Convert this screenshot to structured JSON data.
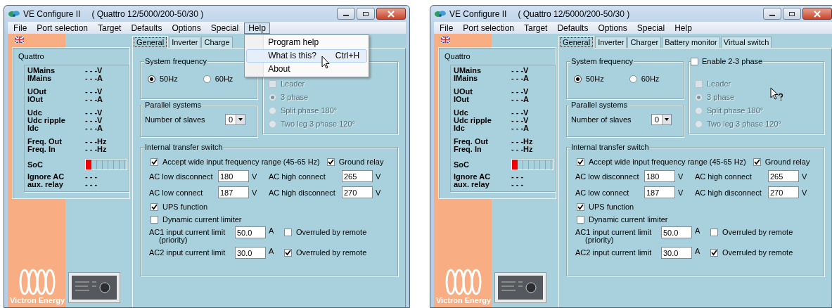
{
  "windows": [
    {
      "title": "VE Configure II",
      "device": "( Quattro 12/5000/200-50/30 )",
      "menu": [
        {
          "label": "File",
          "selected": false
        },
        {
          "label": "Port selection",
          "selected": false
        },
        {
          "label": "Target",
          "selected": false
        },
        {
          "label": "Defaults",
          "selected": false
        },
        {
          "label": "Options",
          "selected": false
        },
        {
          "label": "Special",
          "selected": false
        },
        {
          "label": "Help",
          "selected": true
        }
      ],
      "dropdown": [
        {
          "label": "Program help",
          "selected": false
        },
        {
          "label": "What is this?",
          "shortcut": "Ctrl+H",
          "selected": true
        },
        {
          "label": "About",
          "selected": false
        }
      ],
      "status": {
        "device": "Quattro",
        "groups": [
          [
            {
              "kind": "reading",
              "label": "UMains",
              "value": "- - -V"
            },
            {
              "kind": "reading",
              "label": "IMains",
              "value": "- - -A"
            }
          ],
          [
            {
              "kind": "reading",
              "label": "UOut",
              "value": "- - -V"
            },
            {
              "kind": "reading",
              "label": "IOut",
              "value": "- - -A"
            }
          ],
          [
            {
              "kind": "reading",
              "label": "Udc",
              "value": "- - -V"
            },
            {
              "kind": "reading",
              "label": "Udc ripple",
              "value": "- - -V"
            },
            {
              "kind": "reading",
              "label": "Idc",
              "value": "- - -A"
            }
          ],
          [
            {
              "kind": "reading",
              "label": "Freq. Out",
              "value": "- - -Hz"
            },
            {
              "kind": "reading",
              "label": "Freq. In",
              "value": "- - -Hz"
            }
          ],
          [
            {
              "kind": "meter",
              "label": "SoC",
              "level": 0.14
            },
            {
              "kind": "reading",
              "label": "Ignore AC",
              "value": "- - -"
            },
            {
              "kind": "reading",
              "label": "aux. relay",
              "value": "- - -"
            }
          ]
        ]
      },
      "tabs": [
        {
          "label": "General",
          "selected": true
        },
        {
          "label": "Inverter",
          "selected": false
        },
        {
          "label": "Charge",
          "selected": false
        }
      ],
      "frequency": {
        "title": "System frequency",
        "options": [
          {
            "label": "50Hz",
            "selected": true
          },
          {
            "label": "60Hz",
            "selected": false
          }
        ]
      },
      "parallel": {
        "title": "Parallel systems",
        "label": "Number of slaves",
        "value": "0"
      },
      "phase": {
        "options": [
          {
            "kind": "checkbox",
            "label": "Leader",
            "checked": false,
            "disabled": true
          },
          {
            "kind": "radio",
            "label": "3 phase",
            "selected": true,
            "disabled": true
          },
          {
            "kind": "radio",
            "label": "Split phase 180°",
            "selected": false,
            "disabled": true
          },
          {
            "kind": "radio",
            "label": "Two leg 3 phase 120°",
            "selected": false,
            "disabled": true
          }
        ]
      },
      "transfer": {
        "title": "Internal transfer switch",
        "rows": [
          {
            "kind": "checks",
            "checks": [
              {
                "label": "Accept wide input frequency range (45-65 Hz)",
                "checked": true
              },
              {
                "label": "Ground relay",
                "checked": true
              }
            ]
          },
          {
            "kind": "fields",
            "fields": [
              {
                "label": "AC low disconnect",
                "value": "180",
                "unit": "V"
              },
              {
                "label": "AC high connect",
                "value": "265",
                "unit": "V"
              }
            ]
          },
          {
            "kind": "fields",
            "fields": [
              {
                "label": "AC low connect",
                "value": "187",
                "unit": "V"
              },
              {
                "label": "AC high disconnect",
                "value": "270",
                "unit": "V"
              }
            ]
          },
          {
            "kind": "checks",
            "checks": [
              {
                "label": "UPS function",
                "checked": true
              }
            ]
          },
          {
            "kind": "checks",
            "checks": [
              {
                "label": "Dynamic current limiter",
                "checked": false
              }
            ]
          },
          {
            "kind": "limit",
            "label": "AC1 input current limit",
            "note": "(priority)",
            "value": "50.0",
            "unit": "A",
            "check": {
              "label": "Overruled by remote",
              "checked": false
            }
          },
          {
            "kind": "limit",
            "label": "AC2 input current limit",
            "value": "30.0",
            "unit": "A",
            "check": {
              "label": "Overruled by remote",
              "checked": true
            }
          }
        ]
      },
      "logo": "Victron Energy"
    },
    {
      "title": "VE Configure II",
      "device": "( Quattro 12/5000/200-50/30 )",
      "menu": [
        {
          "label": "File",
          "selected": false
        },
        {
          "label": "Port selection",
          "selected": false
        },
        {
          "label": "Target",
          "selected": false
        },
        {
          "label": "Defaults",
          "selected": false
        },
        {
          "label": "Options",
          "selected": false
        },
        {
          "label": "Special",
          "selected": false
        },
        {
          "label": "Help",
          "selected": false
        }
      ],
      "status": {
        "device": "Quattro",
        "groups": [
          [
            {
              "kind": "reading",
              "label": "UMains",
              "value": "- - -V"
            },
            {
              "kind": "reading",
              "label": "IMains",
              "value": "- - -A"
            }
          ],
          [
            {
              "kind": "reading",
              "label": "UOut",
              "value": "- - -V"
            },
            {
              "kind": "reading",
              "label": "IOut",
              "value": "- - -A"
            }
          ],
          [
            {
              "kind": "reading",
              "label": "Udc",
              "value": "- - -V"
            },
            {
              "kind": "reading",
              "label": "Udc ripple",
              "value": "- - -V"
            },
            {
              "kind": "reading",
              "label": "Idc",
              "value": "- - -A"
            }
          ],
          [
            {
              "kind": "reading",
              "label": "Freq. Out",
              "value": "- - -Hz"
            },
            {
              "kind": "reading",
              "label": "Freq. In",
              "value": "- - -Hz"
            }
          ],
          [
            {
              "kind": "meter",
              "label": "SoC",
              "level": 0.14
            },
            {
              "kind": "reading",
              "label": "Ignore AC",
              "value": "- - -"
            },
            {
              "kind": "reading",
              "label": "aux. relay",
              "value": "- - -"
            }
          ]
        ]
      },
      "tabs": [
        {
          "label": "General",
          "selected": true
        },
        {
          "label": "Inverter",
          "selected": false
        },
        {
          "label": "Charger",
          "selected": false
        },
        {
          "label": "Battery monitor",
          "selected": false
        },
        {
          "label": "Virtual switch",
          "selected": false
        }
      ],
      "frequency": {
        "title": "System frequency",
        "options": [
          {
            "label": "50Hz",
            "selected": true
          },
          {
            "label": "60Hz",
            "selected": false
          }
        ]
      },
      "parallel": {
        "title": "Parallel systems",
        "label": "Number of slaves",
        "value": "0"
      },
      "phase": {
        "enable": {
          "label": "Enable 2-3 phase",
          "checked": false
        },
        "options": [
          {
            "kind": "checkbox",
            "label": "Leader",
            "checked": false,
            "disabled": true
          },
          {
            "kind": "radio",
            "label": "3 phase",
            "selected": true,
            "disabled": true
          },
          {
            "kind": "radio",
            "label": "Split phase 180°",
            "selected": false,
            "disabled": true
          },
          {
            "kind": "radio",
            "label": "Two leg 3 phase 120°",
            "selected": false,
            "disabled": true
          }
        ]
      },
      "transfer": {
        "title": "Internal transfer switch",
        "rows": [
          {
            "kind": "checks",
            "checks": [
              {
                "label": "Accept wide input frequency range (45-65 Hz)",
                "checked": true
              },
              {
                "label": "Ground relay",
                "checked": true
              }
            ]
          },
          {
            "kind": "fields",
            "fields": [
              {
                "label": "AC low disconnect",
                "value": "180",
                "unit": "V"
              },
              {
                "label": "AC high connect",
                "value": "265",
                "unit": "V"
              }
            ]
          },
          {
            "kind": "fields",
            "fields": [
              {
                "label": "AC low connect",
                "value": "187",
                "unit": "V"
              },
              {
                "label": "AC high disconnect",
                "value": "270",
                "unit": "V"
              }
            ]
          },
          {
            "kind": "checks",
            "checks": [
              {
                "label": "UPS function",
                "checked": true
              }
            ]
          },
          {
            "kind": "checks",
            "checks": [
              {
                "label": "Dynamic current limiter",
                "checked": false
              }
            ]
          },
          {
            "kind": "limit",
            "label": "AC1 input current limit",
            "note": "(priority)",
            "value": "50.0",
            "unit": "A",
            "check": {
              "label": "Overruled by remote",
              "checked": false
            }
          },
          {
            "kind": "limit",
            "label": "AC2 input current limit",
            "value": "30.0",
            "unit": "A",
            "check": {
              "label": "Overruled by remote",
              "checked": true
            }
          }
        ]
      },
      "logo": "Victron Energy"
    }
  ]
}
